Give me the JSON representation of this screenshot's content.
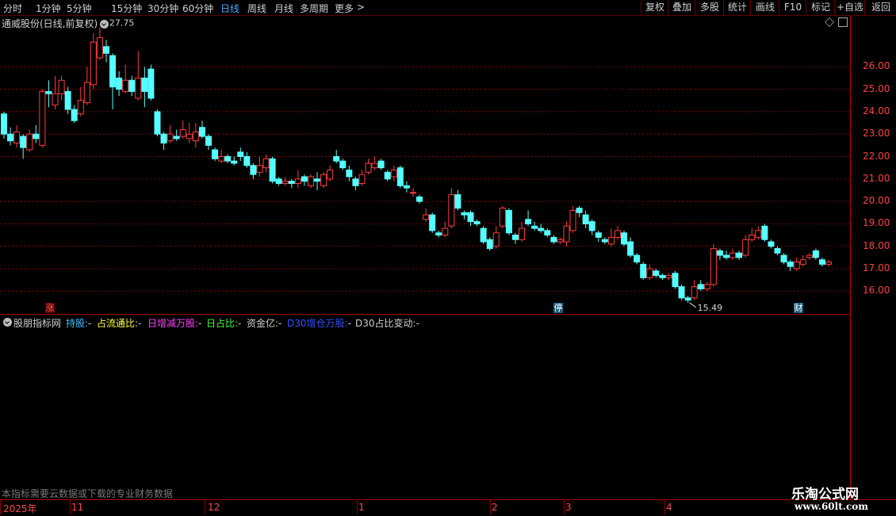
{
  "toolbar": {
    "periods": [
      "分时",
      "1分钟",
      "5分钟",
      "15分钟",
      "30分钟",
      "60分钟",
      "日线",
      "周线",
      "月线",
      "多周期",
      "更多"
    ],
    "active_period": "日线",
    "right_buttons": [
      "复权",
      "叠加",
      "多股",
      "统计",
      "画线",
      "F10",
      "标记",
      "+自选",
      "返回"
    ]
  },
  "stock": {
    "title": "通威股份(日线,前复权)",
    "high_annotation": "27.75",
    "low_annotation": "15.49"
  },
  "markers": {
    "zhang": "涨",
    "ting": "停",
    "cai": "财"
  },
  "indicator": {
    "name": "股朋指标网",
    "items": [
      {
        "label": "持股:",
        "value": "-",
        "color": "#40c0ff"
      },
      {
        "label": "占流通比:",
        "value": "-",
        "color": "#ffff40"
      },
      {
        "label": "日增减万股:",
        "value": "-",
        "color": "#ff40ff"
      },
      {
        "label": "日占比:",
        "value": "-",
        "color": "#40ff40"
      },
      {
        "label": "资金亿:",
        "value": "-",
        "color": "#d0d0d0"
      },
      {
        "label": "D30增仓万股:",
        "value": "-",
        "color": "#3050ff"
      },
      {
        "label": "D30占比变动:",
        "value": "-",
        "color": "#d0d0d0"
      }
    ],
    "note": "本指标需要云数据或下载的专业财务数据"
  },
  "date_axis": [
    "2025年",
    "11",
    "12",
    "1",
    "2",
    "3",
    "4"
  ],
  "watermark": {
    "line1": "乐淘公式网",
    "line2": "www.60lt.com"
  },
  "colors": {
    "up": "#ff3c3c",
    "down": "#54ffff",
    "grid": "#8a0000",
    "axis_text": "#ff4040"
  },
  "chart_data": {
    "type": "candlestick",
    "y_ticks": [
      16.0,
      17.0,
      18.0,
      19.0,
      20.0,
      21.0,
      22.0,
      23.0,
      24.0,
      25.0,
      26.0
    ],
    "y_tick_labels": [
      "16.00",
      "17.00",
      "18.00",
      "19.00",
      "20.00",
      "21.00",
      "22.00",
      "23.00",
      "24.00",
      "25.00",
      "26.00"
    ],
    "ylim": [
      15.2,
      28.2
    ],
    "high": 27.75,
    "low": 15.49,
    "candles": [
      [
        23.9,
        23.0,
        24.0,
        22.8
      ],
      [
        23.0,
        22.7,
        23.3,
        22.5
      ],
      [
        22.6,
        23.1,
        23.4,
        22.4
      ],
      [
        22.9,
        22.4,
        23.0,
        21.9
      ],
      [
        22.3,
        23.0,
        23.2,
        22.2
      ],
      [
        23.0,
        22.8,
        23.4,
        22.6
      ],
      [
        22.5,
        24.9,
        25.0,
        22.4
      ],
      [
        24.9,
        24.8,
        25.4,
        24.2
      ],
      [
        24.3,
        24.8,
        25.6,
        24.1
      ],
      [
        24.8,
        25.4,
        25.6,
        24.5
      ],
      [
        24.9,
        24.1,
        25.1,
        23.9
      ],
      [
        24.1,
        23.6,
        24.3,
        23.5
      ],
      [
        23.9,
        24.5,
        25.1,
        23.8
      ],
      [
        24.4,
        25.3,
        26.0,
        24.3
      ],
      [
        25.2,
        27.1,
        27.5,
        25.0
      ],
      [
        26.4,
        27.3,
        27.75,
        26.3
      ],
      [
        26.9,
        26.6,
        27.2,
        26.2
      ],
      [
        26.5,
        25.1,
        26.6,
        24.1
      ],
      [
        25.5,
        25.0,
        25.8,
        24.7
      ],
      [
        24.9,
        25.4,
        26.1,
        24.8
      ],
      [
        25.4,
        24.9,
        25.6,
        24.7
      ],
      [
        24.6,
        25.5,
        26.7,
        24.5
      ],
      [
        25.5,
        24.9,
        26.0,
        24.2
      ],
      [
        25.9,
        24.6,
        26.1,
        24.5
      ],
      [
        24.0,
        23.0,
        24.1,
        22.9
      ],
      [
        23.0,
        22.6,
        23.1,
        22.3
      ],
      [
        22.7,
        23.0,
        23.4,
        22.6
      ],
      [
        22.9,
        22.8,
        23.2,
        22.7
      ],
      [
        22.9,
        23.2,
        23.6,
        22.8
      ],
      [
        22.8,
        23.0,
        23.5,
        22.6
      ],
      [
        22.7,
        23.1,
        23.5,
        22.4
      ],
      [
        23.3,
        22.9,
        23.6,
        22.8
      ],
      [
        22.9,
        22.5,
        23.0,
        22.3
      ],
      [
        22.3,
        21.9,
        22.4,
        21.8
      ],
      [
        21.8,
        22.0,
        22.3,
        21.7
      ],
      [
        22.0,
        21.8,
        22.1,
        21.7
      ],
      [
        21.8,
        21.7,
        22.0,
        21.6
      ],
      [
        22.2,
        22.0,
        22.4,
        21.8
      ],
      [
        22.0,
        21.6,
        22.2,
        21.5
      ],
      [
        21.6,
        21.2,
        21.7,
        21.0
      ],
      [
        21.3,
        21.6,
        22.0,
        21.1
      ],
      [
        21.5,
        21.9,
        22.1,
        21.3
      ],
      [
        21.9,
        20.9,
        22.0,
        20.8
      ],
      [
        21.0,
        20.8,
        21.1,
        20.7
      ],
      [
        20.8,
        20.9,
        21.1,
        20.7
      ],
      [
        20.9,
        20.8,
        21.0,
        20.6
      ],
      [
        20.8,
        21.0,
        21.4,
        20.6
      ],
      [
        21.1,
        20.9,
        21.2,
        20.7
      ],
      [
        20.7,
        21.1,
        21.2,
        20.6
      ],
      [
        21.0,
        20.9,
        21.3,
        20.5
      ],
      [
        20.7,
        21.2,
        21.3,
        20.6
      ],
      [
        21.0,
        21.4,
        21.6,
        20.9
      ],
      [
        22.0,
        21.8,
        22.3,
        21.7
      ],
      [
        21.8,
        21.5,
        21.9,
        21.4
      ],
      [
        21.4,
        21.1,
        21.6,
        20.9
      ],
      [
        21.0,
        20.7,
        21.1,
        20.5
      ],
      [
        20.8,
        21.2,
        21.4,
        20.7
      ],
      [
        21.3,
        21.7,
        21.9,
        21.2
      ],
      [
        21.5,
        21.7,
        22.0,
        21.4
      ],
      [
        21.8,
        21.5,
        21.9,
        21.4
      ],
      [
        21.3,
        21.0,
        21.4,
        20.9
      ],
      [
        21.1,
        21.4,
        21.6,
        20.9
      ],
      [
        21.5,
        20.7,
        21.6,
        20.6
      ],
      [
        20.7,
        20.6,
        20.9,
        20.4
      ],
      [
        20.4,
        20.4,
        20.6,
        20.2
      ],
      [
        20.2,
        20.0,
        20.3,
        19.9
      ],
      [
        19.2,
        19.4,
        19.7,
        19.1
      ],
      [
        19.4,
        18.7,
        19.5,
        18.6
      ],
      [
        18.6,
        18.5,
        18.7,
        18.4
      ],
      [
        18.5,
        18.8,
        19.1,
        18.4
      ],
      [
        18.9,
        20.3,
        20.6,
        18.8
      ],
      [
        20.3,
        19.7,
        20.5,
        19.6
      ],
      [
        19.5,
        19.4,
        19.6,
        19.2
      ],
      [
        19.5,
        19.1,
        19.6,
        18.9
      ],
      [
        19.1,
        19.0,
        19.2,
        18.9
      ],
      [
        18.8,
        18.2,
        18.9,
        18.1
      ],
      [
        18.3,
        17.9,
        18.4,
        17.8
      ],
      [
        18.0,
        18.6,
        18.9,
        17.9
      ],
      [
        18.9,
        19.7,
        19.8,
        18.8
      ],
      [
        19.6,
        18.6,
        19.7,
        18.5
      ],
      [
        18.5,
        18.3,
        18.6,
        18.1
      ],
      [
        18.3,
        18.8,
        19.1,
        18.2
      ],
      [
        19.2,
        19.0,
        19.6,
        18.9
      ],
      [
        18.9,
        18.8,
        19.1,
        18.7
      ],
      [
        18.8,
        18.7,
        19.0,
        18.6
      ],
      [
        18.7,
        18.5,
        18.8,
        18.4
      ],
      [
        18.4,
        18.2,
        18.5,
        18.1
      ],
      [
        18.2,
        18.3,
        18.4,
        18.1
      ],
      [
        18.2,
        18.9,
        19.1,
        18.0
      ],
      [
        18.7,
        19.6,
        19.8,
        18.6
      ],
      [
        19.7,
        19.5,
        19.8,
        19.3
      ],
      [
        19.4,
        19.0,
        19.6,
        18.8
      ],
      [
        19.1,
        18.7,
        19.2,
        18.5
      ],
      [
        18.6,
        18.4,
        18.7,
        18.2
      ],
      [
        18.3,
        18.2,
        18.4,
        18.1
      ],
      [
        18.1,
        18.4,
        18.8,
        18.0
      ],
      [
        18.4,
        18.7,
        18.9,
        18.3
      ],
      [
        18.6,
        18.1,
        18.7,
        18.0
      ],
      [
        18.2,
        17.6,
        18.4,
        17.5
      ],
      [
        17.6,
        17.3,
        17.7,
        17.2
      ],
      [
        17.2,
        16.6,
        17.3,
        16.5
      ],
      [
        16.6,
        17.0,
        17.2,
        16.5
      ],
      [
        16.9,
        16.7,
        17.0,
        16.6
      ],
      [
        16.7,
        16.6,
        16.8,
        16.5
      ],
      [
        16.6,
        16.7,
        16.8,
        16.5
      ],
      [
        16.8,
        16.2,
        16.9,
        16.1
      ],
      [
        16.2,
        15.7,
        16.3,
        15.6
      ],
      [
        15.7,
        15.6,
        15.8,
        15.49
      ],
      [
        15.7,
        16.2,
        16.5,
        15.6
      ],
      [
        16.3,
        16.1,
        16.5,
        16.0
      ],
      [
        16.1,
        16.3,
        16.4,
        16.0
      ],
      [
        16.3,
        17.9,
        18.1,
        16.2
      ],
      [
        17.8,
        17.6,
        17.9,
        17.4
      ],
      [
        17.6,
        17.5,
        17.8,
        17.4
      ],
      [
        17.5,
        17.7,
        17.9,
        17.4
      ],
      [
        17.7,
        17.5,
        17.8,
        17.4
      ],
      [
        17.6,
        18.3,
        18.5,
        17.5
      ],
      [
        18.3,
        18.5,
        18.8,
        18.2
      ],
      [
        18.4,
        18.7,
        18.9,
        18.3
      ],
      [
        18.9,
        18.3,
        19.0,
        18.2
      ],
      [
        18.2,
        18.0,
        18.3,
        17.9
      ],
      [
        17.9,
        17.7,
        18.0,
        17.6
      ],
      [
        17.6,
        17.3,
        17.7,
        17.2
      ],
      [
        17.3,
        17.1,
        17.4,
        16.9
      ],
      [
        17.0,
        17.3,
        17.5,
        16.9
      ],
      [
        17.2,
        17.4,
        17.6,
        17.1
      ],
      [
        17.5,
        17.6,
        17.7,
        17.4
      ],
      [
        17.8,
        17.5,
        17.9,
        17.4
      ],
      [
        17.4,
        17.2,
        17.5,
        17.1
      ],
      [
        17.2,
        17.3,
        17.4,
        17.1
      ]
    ]
  }
}
